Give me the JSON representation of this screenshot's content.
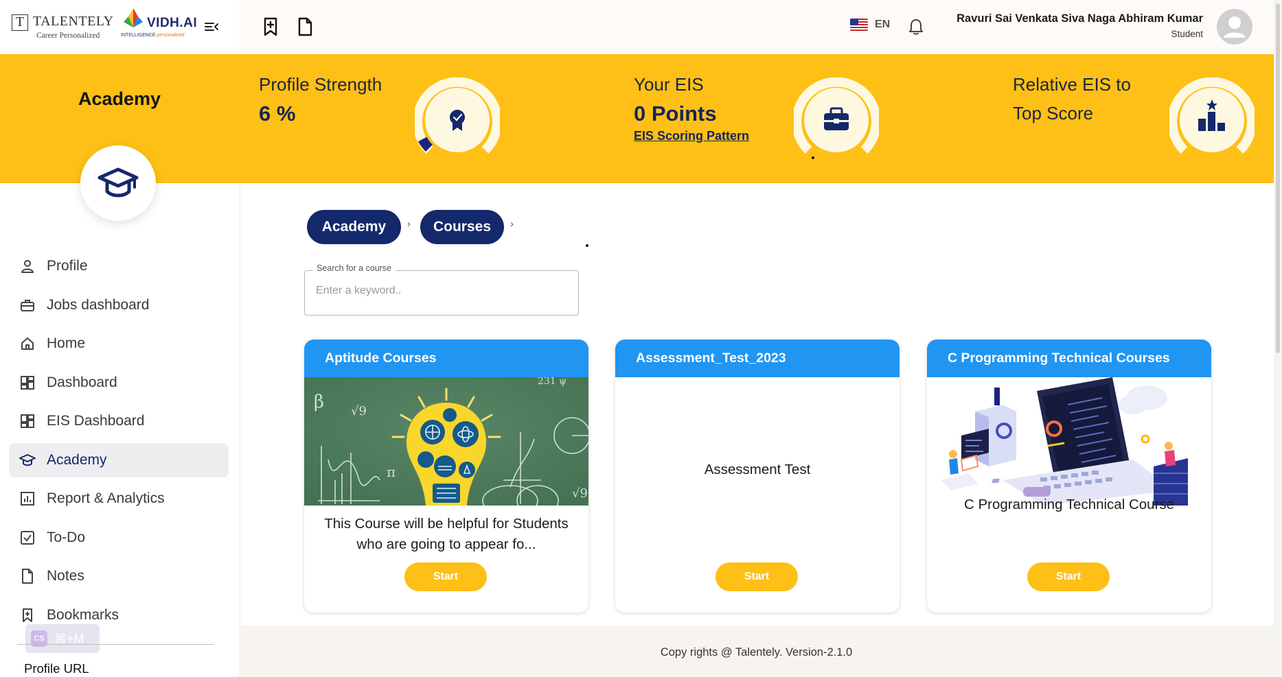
{
  "brand": {
    "talentely_mark": "T",
    "talentely_name": "TALENTELY",
    "talentely_tagline": "Career Personalized",
    "vidh_name": "VIDH.AI",
    "vidh_tagline_prefix": "INTELLIGENCE",
    "vidh_tagline_accent": "personalized"
  },
  "header": {
    "language": "EN",
    "user_name": "Ravuri Sai Venkata Siva Naga Abhiram Kumar",
    "user_role": "Student"
  },
  "banner": {
    "section_title": "Academy",
    "profile_strength": {
      "label": "Profile Strength",
      "value": "6 %",
      "percent": 6
    },
    "eis": {
      "label": "Your EIS",
      "value": "0 Points",
      "link": "EIS Scoring Pattern"
    },
    "relative": {
      "label_line1": "Relative EIS to",
      "label_line2": "Top Score"
    }
  },
  "sidebar": {
    "items": [
      {
        "label": "Profile",
        "icon": "person-icon"
      },
      {
        "label": "Jobs dashboard",
        "icon": "briefcase-icon"
      },
      {
        "label": "Home",
        "icon": "home-icon"
      },
      {
        "label": "Dashboard",
        "icon": "dashboard-grid-icon"
      },
      {
        "label": "EIS Dashboard",
        "icon": "dashboard-grid-icon"
      },
      {
        "label": "Academy",
        "icon": "graduation-cap-icon",
        "active": true
      },
      {
        "label": "Report & Analytics",
        "icon": "bar-chart-icon"
      },
      {
        "label": "To-Do",
        "icon": "checkbox-icon"
      },
      {
        "label": "Notes",
        "icon": "document-icon"
      },
      {
        "label": "Bookmarks",
        "icon": "bookmark-icon"
      }
    ],
    "profile_url_label": "Profile URL",
    "shortcut_badge": "⌘+M",
    "shortcut_icon_text": "CS"
  },
  "breadcrumb": {
    "items": [
      "Academy",
      "Courses"
    ],
    "separator": "›"
  },
  "search": {
    "legend": "Search for a course",
    "placeholder": "Enter a keyword..",
    "value": ""
  },
  "courses": [
    {
      "title": "Aptitude Courses",
      "description": "This Course will be helpful for Students who are going to appear fo...",
      "button": "Start",
      "image": "chalkboard-lightbulb-illustration"
    },
    {
      "title": "Assessment_Test_2023",
      "description": "Assessment Test",
      "button": "Start"
    },
    {
      "title": "C Programming Technical Courses",
      "description": "C Programming Technical Course",
      "button": "Start",
      "image": "laptop-coding-illustration"
    }
  ],
  "footer": {
    "text": "Copy rights @ Talentely.  Version-2.1.0"
  },
  "colors": {
    "brand_yellow": "#fec016",
    "navy": "#14286c",
    "card_header_blue": "#2195f2"
  }
}
